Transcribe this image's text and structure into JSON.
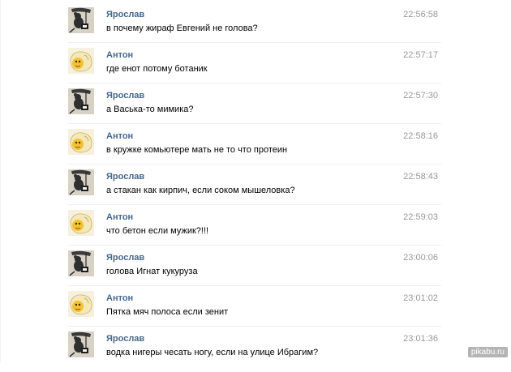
{
  "messages": [
    {
      "author": "Ярослав",
      "avatar": "rat-photographer-avatar",
      "time": "22:56:58",
      "text": "в почему жираф Евгений не голова?"
    },
    {
      "author": "Антон",
      "avatar": "cartoon-chick-avatar",
      "time": "22:57:17",
      "text": "где енот потому ботаник"
    },
    {
      "author": "Ярослав",
      "avatar": "rat-photographer-avatar",
      "time": "22:57:30",
      "text": "а Васька-то мимика?"
    },
    {
      "author": "Антон",
      "avatar": "cartoon-chick-avatar",
      "time": "22:58:16",
      "text": "в кружке комьютере мать не то что протеин"
    },
    {
      "author": "Ярослав",
      "avatar": "rat-photographer-avatar",
      "time": "22:58:43",
      "text": "а стакан как кирпич, если соком мышеловка?"
    },
    {
      "author": "Антон",
      "avatar": "cartoon-chick-avatar",
      "time": "22:59:03",
      "text": "что бетон если мужик?!!!"
    },
    {
      "author": "Ярослав",
      "avatar": "rat-photographer-avatar",
      "time": "23:00:06",
      "text": "голова Игнат кукуруза"
    },
    {
      "author": "Антон",
      "avatar": "cartoon-chick-avatar",
      "time": "23:01:02",
      "text": "Пятка мяч полоса если зенит"
    },
    {
      "author": "Ярослав",
      "avatar": "rat-photographer-avatar",
      "time": "23:01:36",
      "text": "водка нигеры чесать ногу, если на улице Ибрагим?"
    }
  ],
  "watermark": "pikabu.ru",
  "colors": {
    "author": "#45688e",
    "time": "#999999",
    "text": "#000000"
  }
}
